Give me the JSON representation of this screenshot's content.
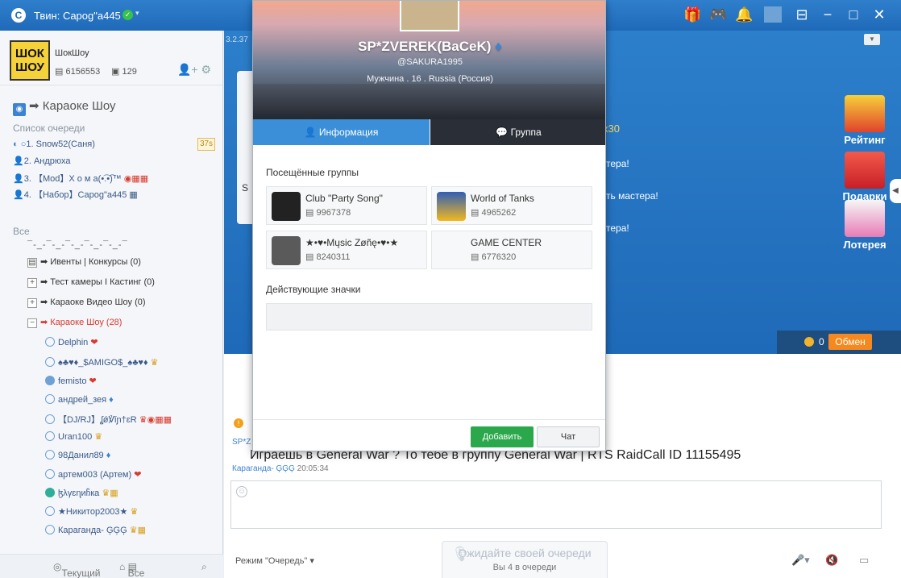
{
  "titlebar": {
    "title": "Твин: Capog\"a445",
    "logo_glyph": "C",
    "status_glyph": "✓",
    "caret": "▾",
    "icons": [
      "gift-icon",
      "gamepad-icon",
      "bell-icon",
      "minimize-to-tray-icon",
      "minimize-icon",
      "maximize-icon",
      "close-icon"
    ]
  },
  "profile": {
    "avatar_text": "ШОК ШОУ",
    "name": "ШокШоу",
    "id": "6156553",
    "count": "129"
  },
  "channel": {
    "title": "Караоке Шоу",
    "queue_title": "Список очереди",
    "queue": [
      {
        "num": "1.",
        "name": "Snow52(Саня)",
        "badge": "37s"
      },
      {
        "num": "2.",
        "name": "Андрюха"
      },
      {
        "num": "3.",
        "name": "【Mod】X o м a(•͡.•͡)™"
      },
      {
        "num": "4.",
        "name": "【Набор】Capog\"a445"
      }
    ],
    "all_title": "Все",
    "dashes": "¯-_-¯-_-¯-_-¯-_-¯-_-¯",
    "folders": [
      {
        "box": "▤",
        "label": "➡ Ивенты | Конкурсы",
        "count": "(0)"
      },
      {
        "box": "+",
        "label": "➡ Тест камеры I Кастинг",
        "count": "(0)"
      },
      {
        "box": "+",
        "label": "➡ Караоке Видео Шоу",
        "count": "(0)"
      },
      {
        "box": "−",
        "label": "➡ Караоке Шоу",
        "count": "(28)"
      }
    ],
    "users": [
      "Delphin",
      "♠♣♥♦_$AMIGO$_♠♣♥♦",
      "femisto",
      "андрей_зея",
      "【DJ/RJ】ʆǿ℣ǐɲ†ɛR",
      "Uran100",
      "98Данил89",
      "артем003 (Артем)",
      "ɮλγɛɳиჩкa",
      "★Никитор2003★",
      "Караганда- ĢĢĢ"
    ]
  },
  "left_bottom": {
    "current": "Текущий",
    "all": "Все"
  },
  "stage": {
    "version": "3.2.37",
    "card_letter": "S",
    "multiplier": "x30",
    "chat_lines": [
      "тера!",
      "ть мастера!",
      "тера!"
    ],
    "ads": [
      "Рейтинг",
      "Подарки",
      "Лотерея"
    ],
    "coins": "0",
    "exchange": "Обмен"
  },
  "chat": {
    "sender_short": "SP*Z",
    "message": "Играешь в General War ? То тебе в группу General War | RTS RaidCall ID 11155495",
    "author": "Караганда- ĢĢĢ",
    "time": "20:05:34",
    "mode": "Режим \"Очередь\"",
    "queue_title": "Ожидайте своей очереди",
    "queue_sub": "Вы 4 в очереди"
  },
  "modal": {
    "name": "SP*ZVEREK(BaCeK)",
    "handle": "@SAKURA1995",
    "meta": "Мужчина . 16 . Russia (Россия)",
    "tab_info": "Информация",
    "tab_group": "Группа",
    "groups_title": "Посещённые группы",
    "groups": [
      {
        "name": "Club \"Party Song\"",
        "id": "9967378"
      },
      {
        "name": "World of Tanks",
        "id": "4965262"
      },
      {
        "name": "★•♥•Mųsic Zøñę•♥•★",
        "id": "8240311"
      },
      {
        "name": "GAME CENTER",
        "id": "6776320"
      }
    ],
    "badges_title": "Действующие значки",
    "add": "Добавить",
    "chat": "Чат"
  }
}
